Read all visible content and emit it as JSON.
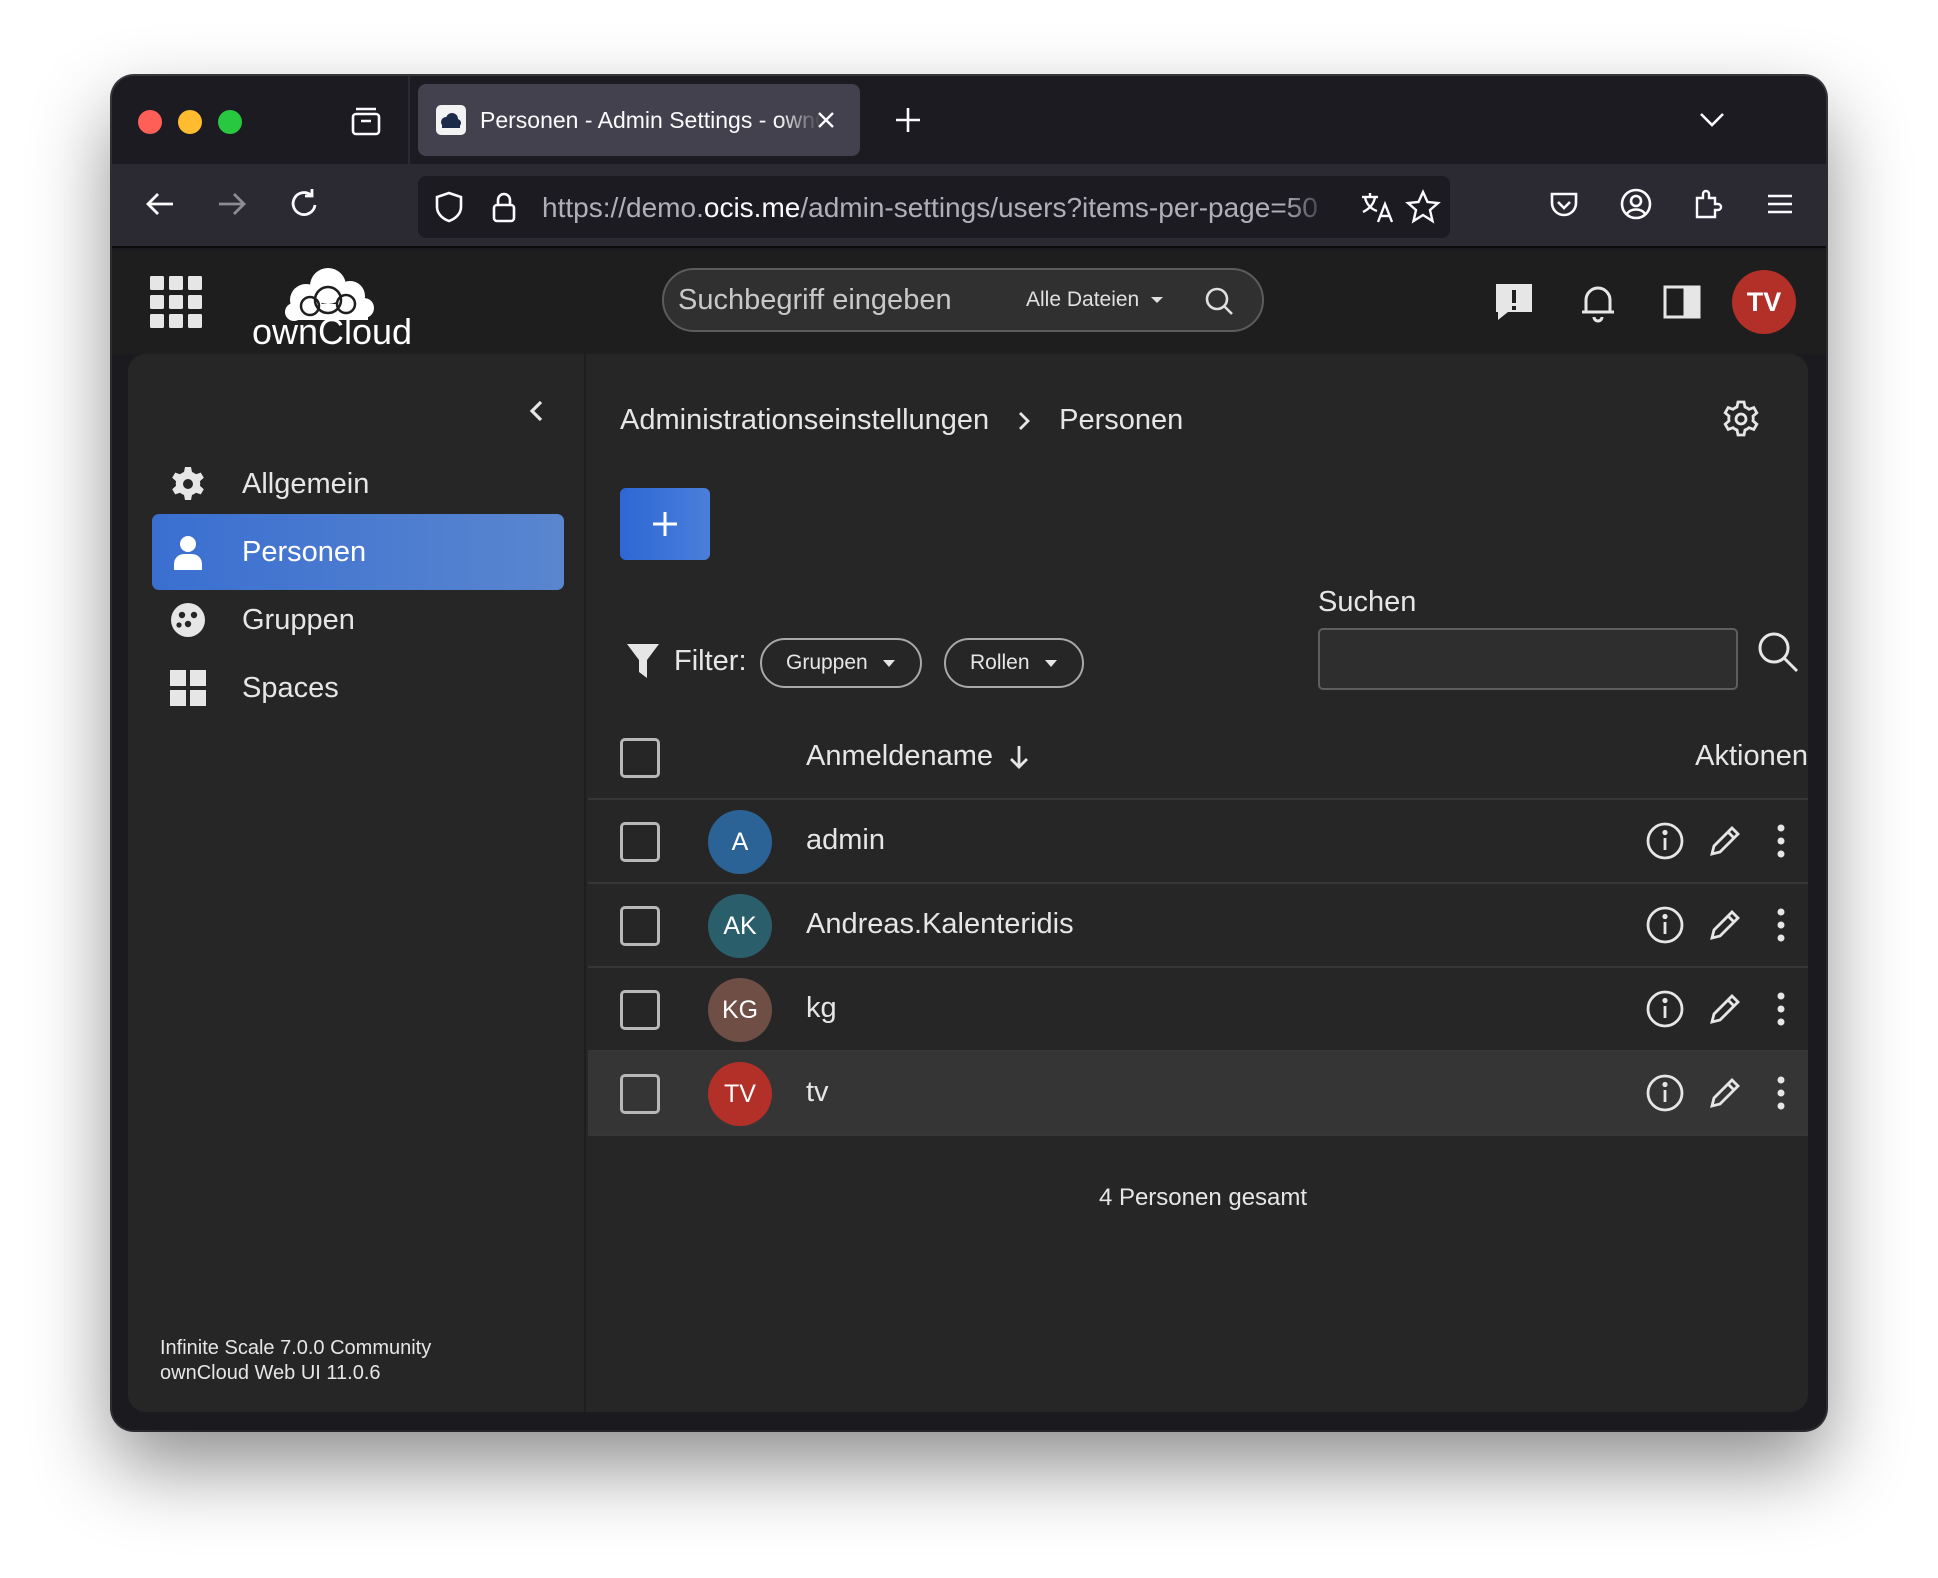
{
  "browser": {
    "tab_title": "Personen - Admin Settings - ownCloud",
    "url_prefix": "https://demo.",
    "url_host": "ocis.me",
    "url_path": "/admin-settings/users?items-per-page=50"
  },
  "header": {
    "logo_text": "ownCloud",
    "search_placeholder": "Suchbegriff eingeben",
    "search_scope": "Alle Dateien",
    "user_initials": "TV"
  },
  "sidebar": {
    "items": [
      {
        "label": "Allgemein",
        "icon": "gear-icon",
        "active": false
      },
      {
        "label": "Personen",
        "icon": "person-icon",
        "active": true
      },
      {
        "label": "Gruppen",
        "icon": "group-icon",
        "active": false
      },
      {
        "label": "Spaces",
        "icon": "grid-icon",
        "active": false
      }
    ],
    "version_line1": "Infinite Scale 7.0.0 Community",
    "version_line2": "ownCloud Web UI 11.0.6"
  },
  "main": {
    "breadcrumb": [
      "Administrationseinstellungen",
      "Personen"
    ],
    "filter_label": "Filter:",
    "filter_groups": "Gruppen",
    "filter_roles": "Rollen",
    "search_label": "Suchen",
    "search_value": "",
    "col_name": "Anmeldename",
    "col_actions": "Aktionen",
    "users": [
      {
        "initials": "A",
        "name": "admin",
        "color": "#2b6396"
      },
      {
        "initials": "AK",
        "name": "Andreas.Kalenteridis",
        "color": "#2a5e6b"
      },
      {
        "initials": "KG",
        "name": "kg",
        "color": "#6e4e45"
      },
      {
        "initials": "TV",
        "name": "tv",
        "color": "#b33028"
      }
    ],
    "total": "4 Personen gesamt"
  },
  "colors": {
    "accent": "#3a6fd1",
    "background": "#262626",
    "text": "#e6e6e6"
  }
}
